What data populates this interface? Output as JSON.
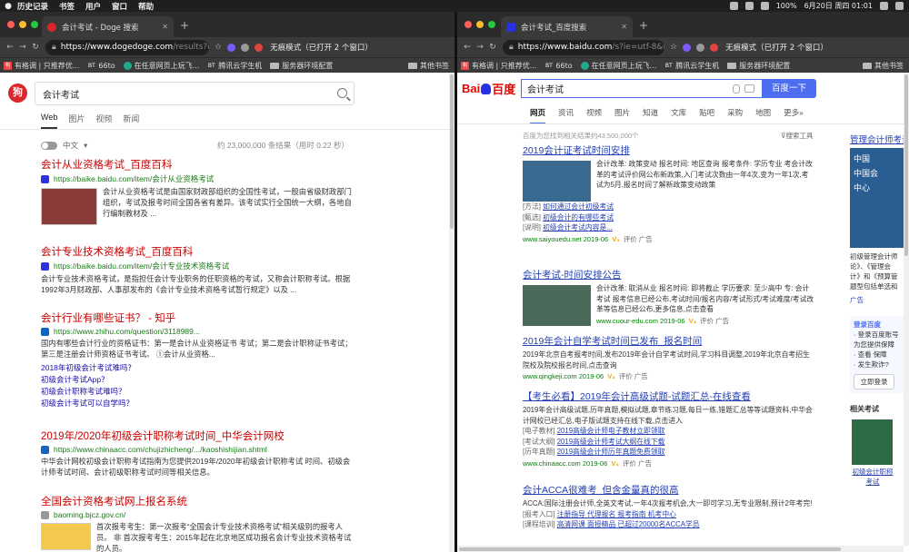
{
  "menubar": {
    "items": [
      "历史记录",
      "书签",
      "用户",
      "窗口",
      "帮助"
    ],
    "battery": "100%",
    "clock": "6月20日 周四 01:01"
  },
  "left": {
    "tab_title": "会计考试 - Doge 搜索",
    "url_host": "https://www.dogedoge.com",
    "url_rest": "/results?q=...",
    "incognito": "无痕模式（已打开 2 个窗口）",
    "bookmarks": [
      "有格调 | 只推荐优...",
      "66to",
      "在任意网页上玩飞...",
      "腾讯云学生机",
      "服务器环境配置"
    ],
    "bookmark_other": "其他书签",
    "logo": "狗",
    "query": "会计考试",
    "tabs": [
      "Web",
      "图片",
      "视频",
      "新闻"
    ],
    "lang": "中文",
    "count": "约 23,000,000 条结果（用时 0.22 秒）",
    "results": [
      {
        "title": "会计从业资格考试_百度百科",
        "url": "https://baike.baidu.com/item/会计从业资格考试",
        "snippet": "会计从业资格考试是由国家财政部组织的全国性考试，一般由省级财政部门组织，考试及报考时间全国各省有差异。该考试实行全国统一大纲，各地自行编制教材及 ..."
      },
      {
        "title": "会计专业技术资格考试_百度百科",
        "url": "https://baike.baidu.com/item/会计专业技术资格考试",
        "snippet": "会计专业技术资格考试，是指担任会计专业职务的任职资格的考试，又称会计职称考试。根据1992年3月财政部、人事部发布的《会计专业技术资格考试暂行规定》以及 ..."
      },
      {
        "title": "会计行业有哪些证书？ - 知乎",
        "url": "https://www.zhihu.com/question/3118989...",
        "snippet": "国内有哪些会计行业的资格证书：第一是会计从业资格证书 考试；第二是会计职称证书考试；第三是注册会计师资格证书考试。 ①会计从业资格...",
        "sublinks": [
          "2018年初级会计考试难吗？",
          "初级会计考试App？",
          "初级会计职称考试难吗？",
          "初级会计考试可以自学吗？"
        ]
      },
      {
        "title": "2019年/2020年初级会计职称考试时间_中华会计网校",
        "url": "https://www.chinaacc.com/chujizhicheng/.../kaoshishijian.shtml",
        "snippet": "中华会计网校初级会计职称考试指南为您提供2019年/2020年初级会计职称考试 时间、初级会计师考试时间、会计初级职称考试时间等相关信息。"
      },
      {
        "title": "全国会计资格考试网上报名系统",
        "url": "baoming.bjcz.gov.cn/",
        "snippet": "首次报考考生：第一次报考“全国会计专业技术资格考试”相关级别的报考人员。 非 首次报考考生：2015年起在北京地区成功报名会计专业技术资格考试的人员。"
      }
    ]
  },
  "right": {
    "tab_title": "会计考试_百度搜索",
    "url_host": "https://www.baidu.com",
    "url_rest": "/s?ie=utf-8&f=8...",
    "incognito": "无痕模式（已打开 2 个窗口）",
    "bookmarks": [
      "有格调 | 只推荐优...",
      "66to",
      "在任意网页上玩飞...",
      "腾讯云学生机",
      "服务器环境配置"
    ],
    "bookmark_other": "其他书签",
    "logo_left": "Bai",
    "logo_right": "百度",
    "query": "会计考试",
    "search_button": "百度一下",
    "tabs": [
      "网页",
      "资讯",
      "视频",
      "图片",
      "知道",
      "文库",
      "贴吧",
      "采购",
      "地图",
      "更多»"
    ],
    "info": "百度为您找到相关结果约43,500,000个",
    "tool": "搜索工具",
    "results": [
      {
        "title": "2019会计证考试时间安排",
        "snippet": "会计改革: 政策变动   报名时间: 地区查询   报考条件: 学历专业   考会计改革的考试评价网公布新政策,入门考试次数由一年4次,变为一年1次,考试为5月,报名时间了解新政策变动政策",
        "links": [
          [
            "[方法]",
            "如何通过会计初级考试"
          ],
          [
            "[甄选]",
            "初级会计的有哪些考试"
          ],
          [
            "[说明]",
            "初级会计考试内容是..."
          ]
        ],
        "source": "www.saiyouedu.net  2019-06",
        "tail": "评价  广告"
      },
      {
        "title": "会计考试-时间安排公告",
        "snippet": "会计改革: 取消从业    报名时间: 即将截止    学历要求: 至少高中    专: 会计考试 报考信息已经公布,考试时间/报名内容/考试形式/考试难度/考试改革等信息已经公布,更多信息,点击查看",
        "links": [],
        "source": "www.cuour-edu.com  2019-06",
        "tail": "评价  广告"
      },
      {
        "title": "2019年会计自学考试时间已发布_报名时间",
        "snippet": "2019年北京自考报考时间,发布2019年会计自学考试时间,学习科目调整,2019年北京自考招生院校及院校报名时间,点击查询",
        "links": [],
        "source": "www.qingkeji.com  2019-06",
        "tail": "评价  广告"
      },
      {
        "title": "【考生必看】2019年会计高级试题-试题汇总-在线查看",
        "snippet": "2019年会计高级试题,历年真题,模拟试题,章节练习题,每日一练,错题汇总等等试题资料,中华会计网校已经汇总,电子版试题支持在线下载,点击进入",
        "links": [
          [
            "[电子教材]",
            "2019高级会计师电子教材立即领取"
          ],
          [
            "[考试大纲]",
            "2019高级会计师考试大纲在线下载"
          ],
          [
            "[历年真题]",
            "2019高级会计师历年真题免费领取"
          ]
        ],
        "source": "www.chinaacc.com  2019-06",
        "tail": "评价  广告"
      },
      {
        "title": "会计ACCA很难考_但含金量真的很高",
        "snippet": "ACCA:国际注册会计师,全英文考试,一年4次报考机会,大一即可学习,无专业限制,预计2年考完!",
        "links": [
          [
            "[报考入口]",
            "注册指导 代理报名 报考指南 机考中心"
          ],
          [
            "[课程培训]",
            "高清网课 面授精品 已超过20000名ACCA学员"
          ]
        ],
        "source": "",
        "tail": ""
      }
    ],
    "side": {
      "title": "管理会计师考试",
      "ad_lines": [
        "中国",
        "中国会",
        "中心"
      ],
      "desc": [
        "初级管理会计师",
        "论》、《管理会",
        "计》和《预算管",
        "题型包括单选和"
      ],
      "ad_label": "广告",
      "card_head": "登录百度",
      "card_lines": [
        "· 登录百度账号",
        "为您提供保障",
        "· 查看 保障",
        "· 发生欺诈?"
      ],
      "card_button": "立即登录",
      "related": "相关考试",
      "book_caption": "初级会计职称考试"
    }
  }
}
